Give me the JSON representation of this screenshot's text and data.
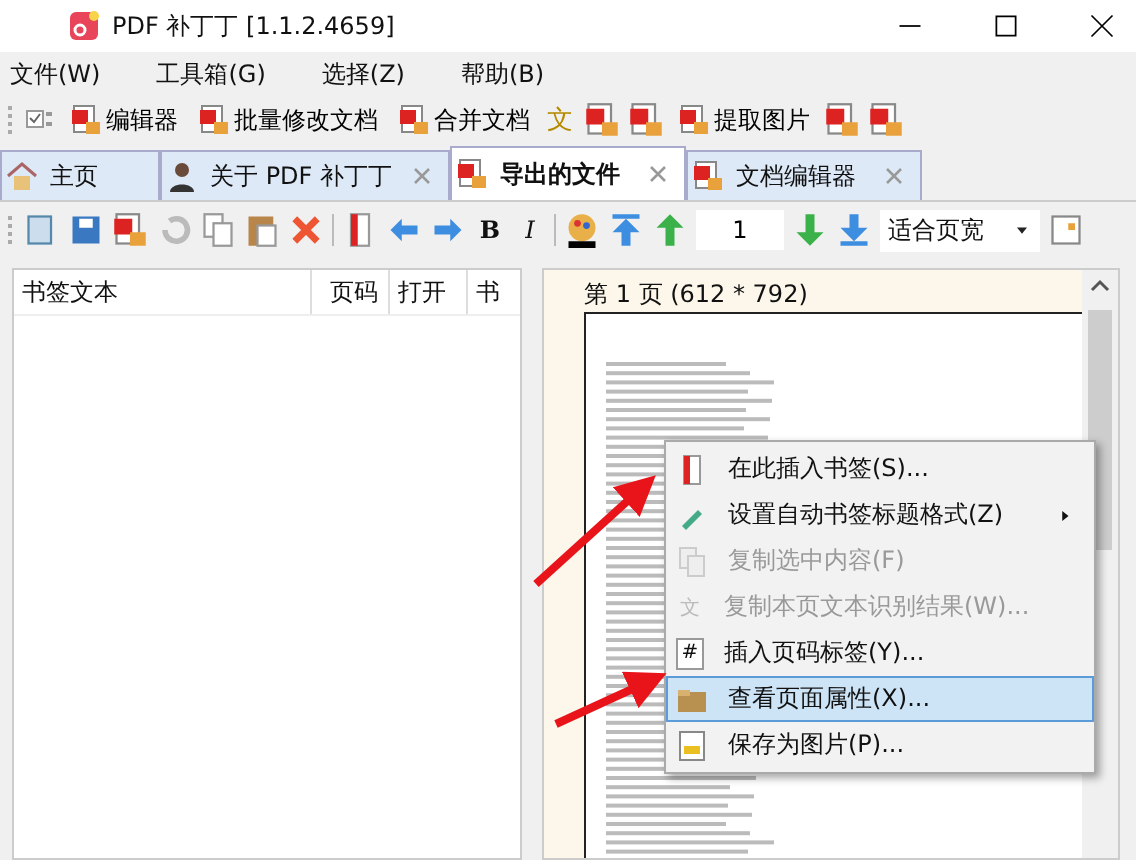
{
  "window": {
    "title": "PDF 补丁丁 [1.1.2.4659]"
  },
  "menu_bar": [
    "文件(W)",
    "工具箱(G)",
    "选择(Z)",
    "帮助(B)"
  ],
  "main_toolbar": [
    {
      "kind": "check"
    },
    {
      "kind": "button",
      "label": "编辑器"
    },
    {
      "kind": "button",
      "label": "批量修改文档"
    },
    {
      "kind": "button",
      "label": "合并文档"
    },
    {
      "kind": "glyph",
      "glyph": "文"
    },
    {
      "kind": "icon"
    },
    {
      "kind": "icon"
    },
    {
      "kind": "button",
      "label": "提取图片"
    },
    {
      "kind": "icon"
    },
    {
      "kind": "icon"
    }
  ],
  "tabs": [
    {
      "label": "主页",
      "selected": false,
      "closable": false
    },
    {
      "label": "关于 PDF 补丁丁",
      "selected": false,
      "closable": true
    },
    {
      "label": "导出的文件",
      "selected": true,
      "closable": true
    },
    {
      "label": "文档编辑器",
      "selected": false,
      "closable": true
    }
  ],
  "editor_toolbar": {
    "bold": "B",
    "italic": "I",
    "page_number": "1",
    "zoom": "适合页宽"
  },
  "bookmark_table": {
    "columns": [
      "书签文本",
      "页码",
      "打开",
      "书"
    ]
  },
  "page_view": {
    "page_label": "第 1 页 (612 * 792)"
  },
  "context_menu": [
    {
      "label": "在此插入书签(S)...",
      "disabled": false,
      "selected": false,
      "submenu": false
    },
    {
      "label": "设置自动书签标题格式(Z)",
      "disabled": false,
      "selected": false,
      "submenu": true
    },
    {
      "label": "复制选中内容(F)",
      "disabled": true,
      "selected": false,
      "submenu": false
    },
    {
      "label": "复制本页文本识别结果(W)...",
      "disabled": true,
      "selected": false,
      "submenu": false,
      "icon_glyph": "文"
    },
    {
      "label": "插入页码标签(Y)...",
      "disabled": false,
      "selected": false,
      "submenu": false,
      "icon_glyph": "#"
    },
    {
      "label": "查看页面属性(X)...",
      "disabled": false,
      "selected": true,
      "submenu": false
    },
    {
      "label": "保存为图片(P)...",
      "disabled": false,
      "selected": false,
      "submenu": false
    }
  ]
}
